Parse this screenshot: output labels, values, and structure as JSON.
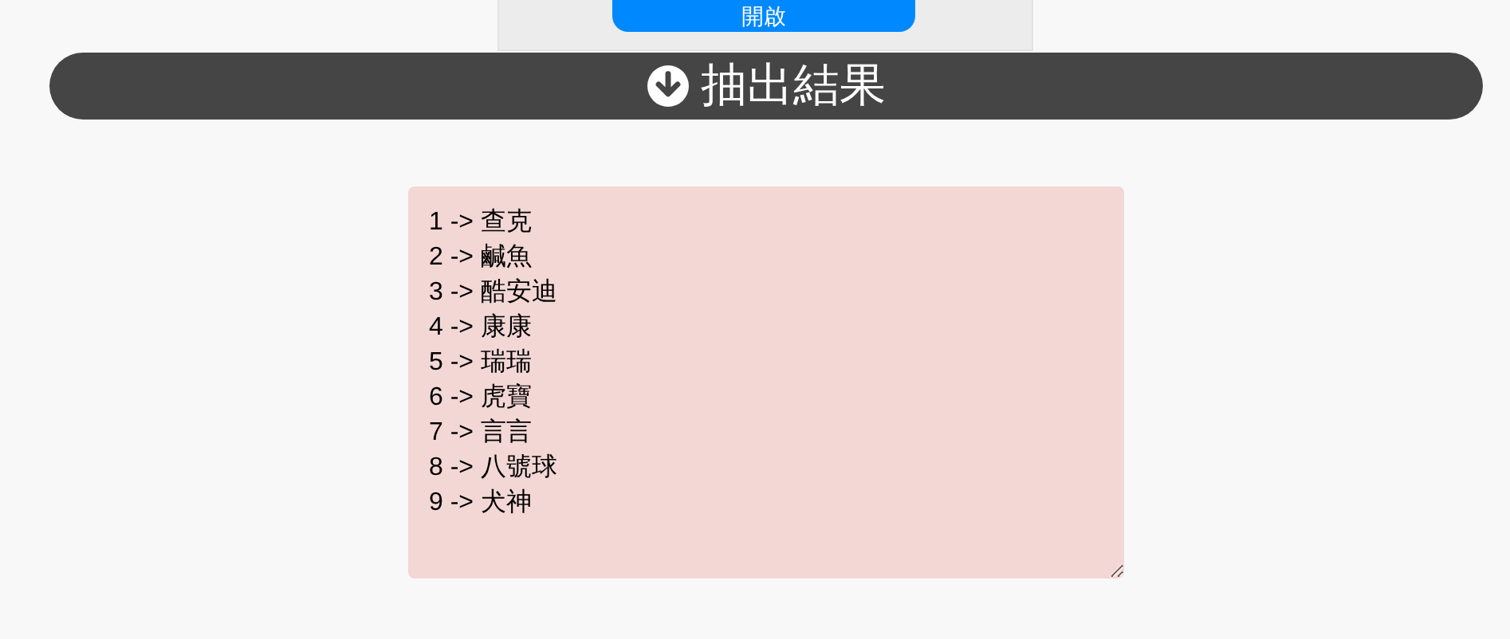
{
  "top_panel": {
    "button": "開啟"
  },
  "section_header": {
    "title": "抽出結果"
  },
  "result_box": {
    "value": "1 -> 查克\n2 -> 鹹魚\n3 -> 酷安迪\n4 -> 康康\n5 -> 瑞瑞\n6 -> 虎寶\n7 -> 言言\n8 -> 八號球\n9 -> 犬神"
  }
}
